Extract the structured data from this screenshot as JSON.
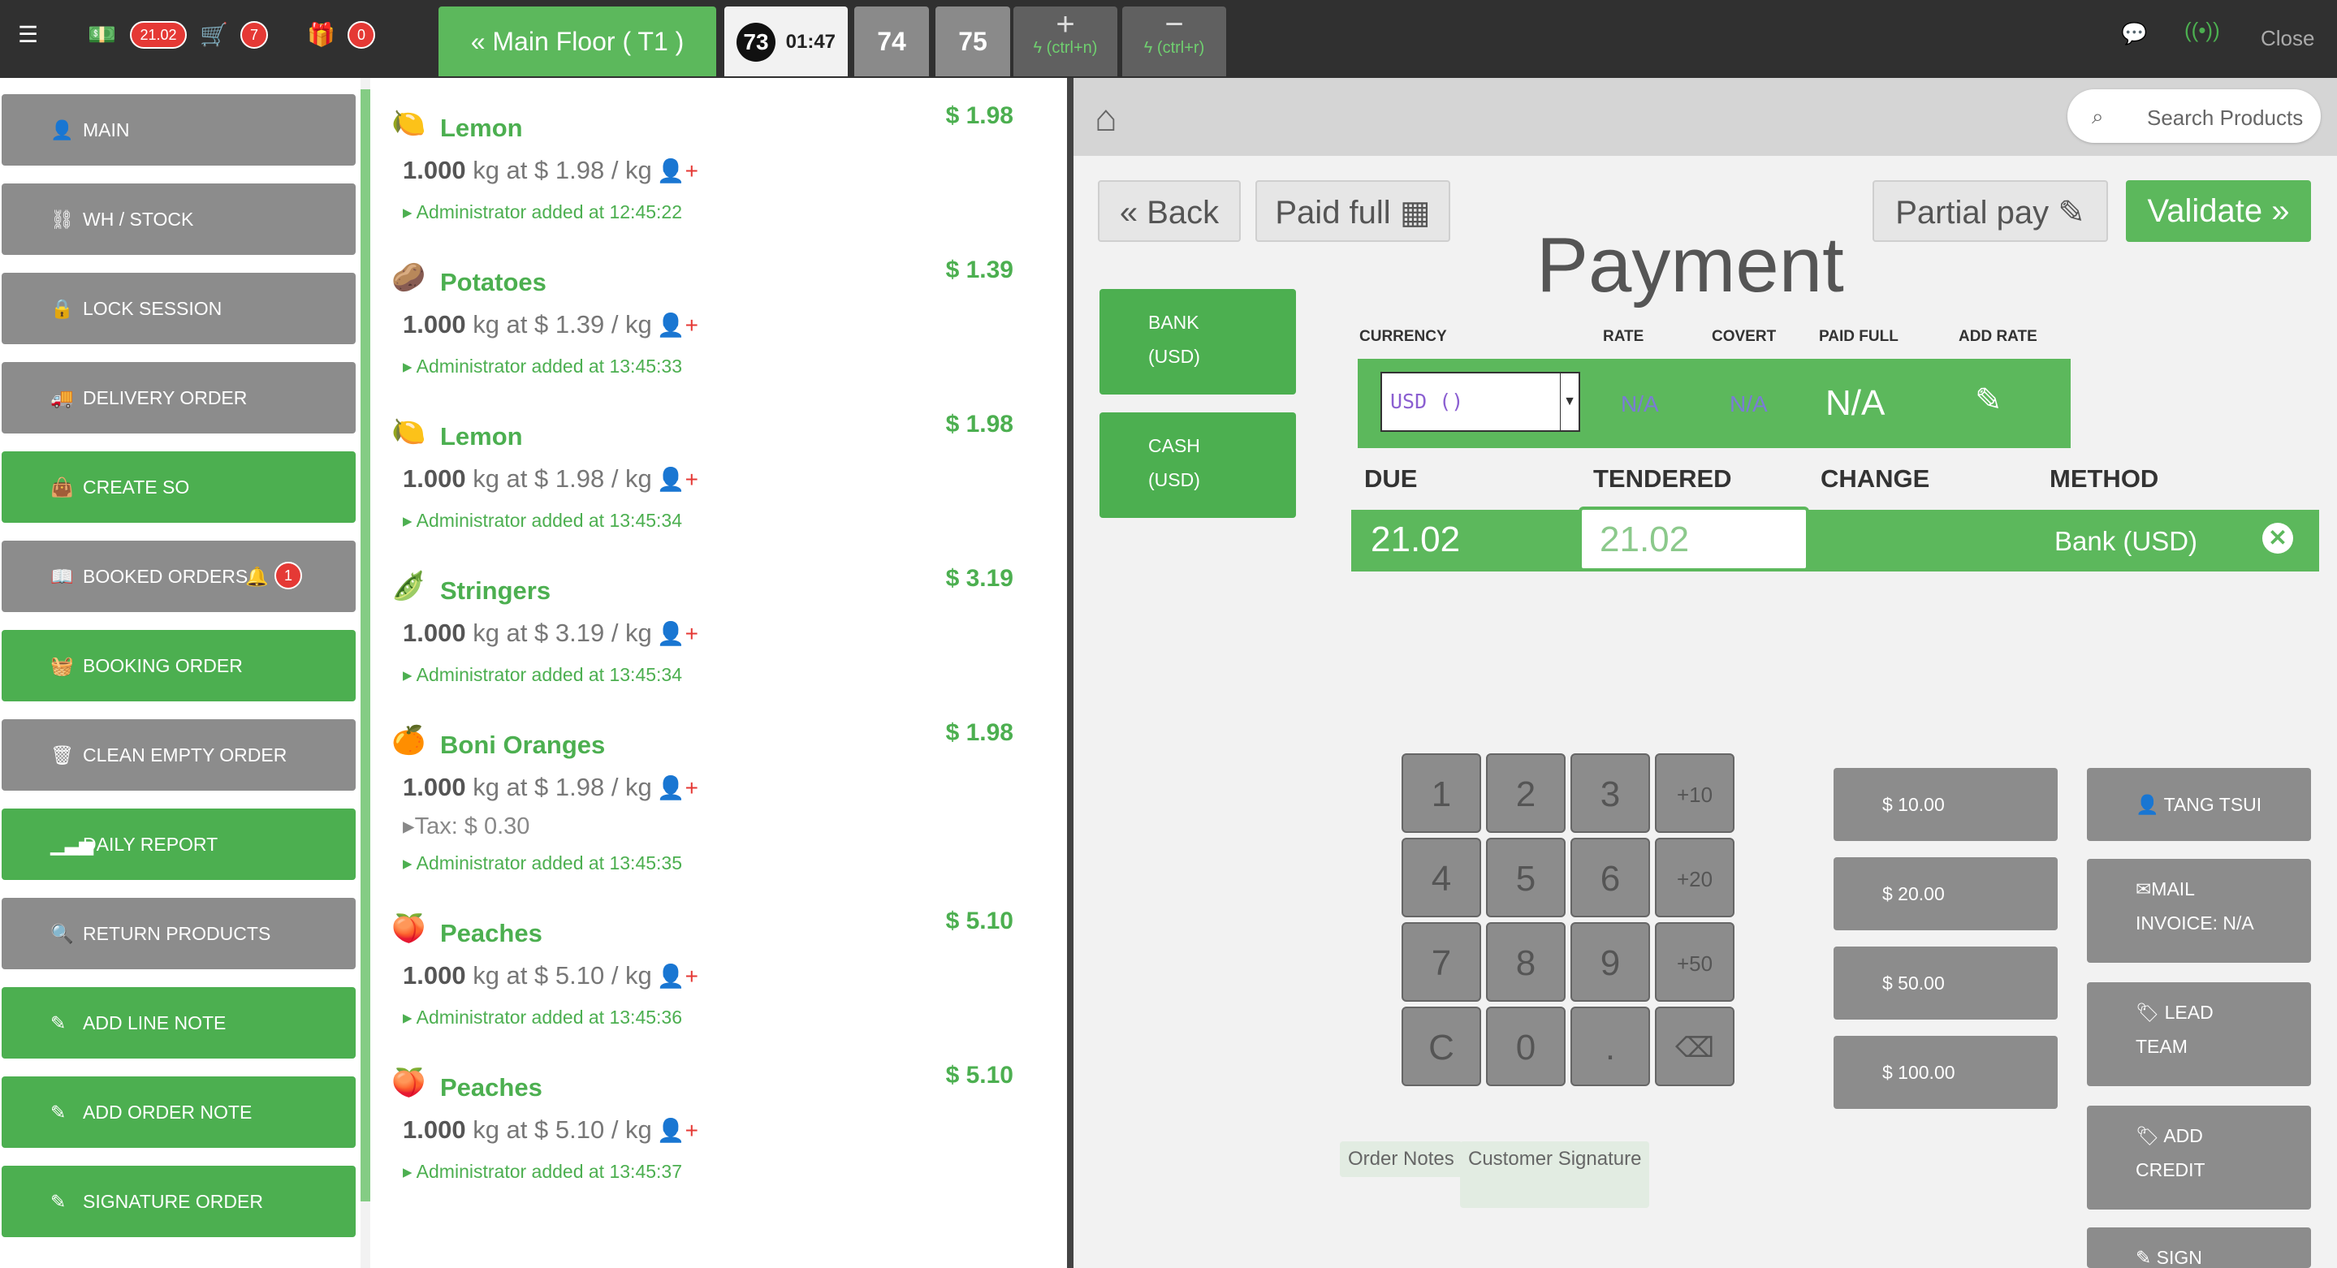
{
  "topbar": {
    "cash_amount": "21.02",
    "cart_count": "7",
    "gift_count": "0",
    "floor_label": "Main Floor ( T1 )",
    "active_order_number": "73",
    "active_order_time": "01:47",
    "order_tabs": [
      "74",
      "75"
    ],
    "add_hint": "(ctrl+n)",
    "remove_hint": "(ctrl+r)",
    "close_label": "Close"
  },
  "sidebar": {
    "items": [
      {
        "label": "MAIN",
        "icon": "user-icon",
        "color": "gray"
      },
      {
        "label": "WH / STOCK",
        "icon": "sitemap-icon",
        "color": "gray"
      },
      {
        "label": "LOCK SESSION",
        "icon": "lock-icon",
        "color": "gray"
      },
      {
        "label": "DELIVERY ORDER",
        "icon": "truck-icon",
        "color": "gray"
      },
      {
        "label": "CREATE SO",
        "icon": "shopping-bag-icon",
        "color": "green"
      },
      {
        "label": "BOOKED ORDERS",
        "icon": "book-icon",
        "color": "gray"
      },
      {
        "label": "BOOKING ORDER",
        "icon": "basket-icon",
        "color": "green"
      },
      {
        "label": "CLEAN EMPTY ORDER",
        "icon": "trash-icon",
        "color": "gray"
      },
      {
        "label": "DAILY REPORT",
        "icon": "signal-icon",
        "color": "green"
      },
      {
        "label": "RETURN PRODUCTS",
        "icon": "search-icon",
        "color": "gray"
      },
      {
        "label": "ADD LINE NOTE",
        "icon": "edit-icon",
        "color": "green"
      },
      {
        "label": "ADD ORDER NOTE",
        "icon": "edit-icon",
        "color": "green"
      },
      {
        "label": "SIGNATURE ORDER",
        "icon": "edit-icon",
        "color": "green"
      }
    ],
    "booked_badge": "1"
  },
  "order_lines": [
    {
      "name": "Lemon",
      "price": "$ 1.98",
      "qty": "1.000",
      "unit_text": "kg at $ 1.98 / kg",
      "added": "Administrator added at 12:45:22",
      "tax": ""
    },
    {
      "name": "Potatoes",
      "price": "$ 1.39",
      "qty": "1.000",
      "unit_text": "kg at $ 1.39 / kg",
      "added": "Administrator added at 13:45:33",
      "tax": ""
    },
    {
      "name": "Lemon",
      "price": "$ 1.98",
      "qty": "1.000",
      "unit_text": "kg at $ 1.98 / kg",
      "added": "Administrator added at 13:45:34",
      "tax": ""
    },
    {
      "name": "Stringers",
      "price": "$ 3.19",
      "qty": "1.000",
      "unit_text": "kg at $ 3.19 / kg",
      "added": "Administrator added at 13:45:34",
      "tax": ""
    },
    {
      "name": "Boni Oranges",
      "price": "$ 1.98",
      "qty": "1.000",
      "unit_text": "kg at $ 1.98 / kg",
      "added": "Administrator added at 13:45:35",
      "tax": "Tax: $ 0.30"
    },
    {
      "name": "Peaches",
      "price": "$ 5.10",
      "qty": "1.000",
      "unit_text": "kg at $ 5.10 / kg",
      "added": "Administrator added at 13:45:36",
      "tax": ""
    },
    {
      "name": "Peaches",
      "price": "$ 5.10",
      "qty": "1.000",
      "unit_text": "kg at $ 5.10 / kg",
      "added": "Administrator added at 13:45:37",
      "tax": ""
    }
  ],
  "payment": {
    "search_placeholder": "Search Products",
    "back_label": "Back",
    "paid_full_label": "Paid full",
    "partial_pay_label": "Partial pay",
    "validate_label": "Validate",
    "title": "Payment",
    "methods": [
      {
        "line1": "BANK",
        "line2": "(USD)"
      },
      {
        "line1": "CASH",
        "line2": "(USD)"
      }
    ],
    "currency_headers": {
      "currency": "CURRENCY",
      "rate": "RATE",
      "covert": "COVERT",
      "paid_full": "PAID FULL",
      "add_rate": "ADD RATE"
    },
    "currency_value": "USD ()",
    "rate": "N/A",
    "covert": "N/A",
    "paid_full": "N/A",
    "line_headers": {
      "due": "DUE",
      "tendered": "TENDERED",
      "change": "CHANGE",
      "method": "METHOD"
    },
    "line": {
      "due": "21.02",
      "tendered": "21.02",
      "change": "",
      "method": "Bank (USD)"
    },
    "keypad": [
      "1",
      "2",
      "3",
      "+10",
      "4",
      "5",
      "6",
      "+20",
      "7",
      "8",
      "9",
      "+50",
      "C",
      "0",
      ".",
      "⌫"
    ],
    "cash_buttons": [
      "$ 10.00",
      "$ 20.00",
      "$ 50.00",
      "$ 100.00"
    ],
    "actions": [
      {
        "line1": "TANG TSUI",
        "line2": "",
        "icon": "user-icon"
      },
      {
        "line1": "MAIL",
        "line2": "INVOICE: N/A",
        "icon": "envelope-icon"
      },
      {
        "line1": "LEAD",
        "line2": "TEAM",
        "icon": "tag-icon"
      },
      {
        "line1": "ADD",
        "line2": "CREDIT",
        "icon": "tag-icon"
      },
      {
        "line1": "SIGN",
        "line2": "",
        "icon": "edit-icon"
      }
    ],
    "order_notes_label": "Order Notes",
    "customer_signature_label": "Customer Signature"
  },
  "colors": {
    "green": "#4caf50",
    "gray": "#8c8c8c",
    "topbar": "#303030",
    "badge": "#e53935"
  }
}
